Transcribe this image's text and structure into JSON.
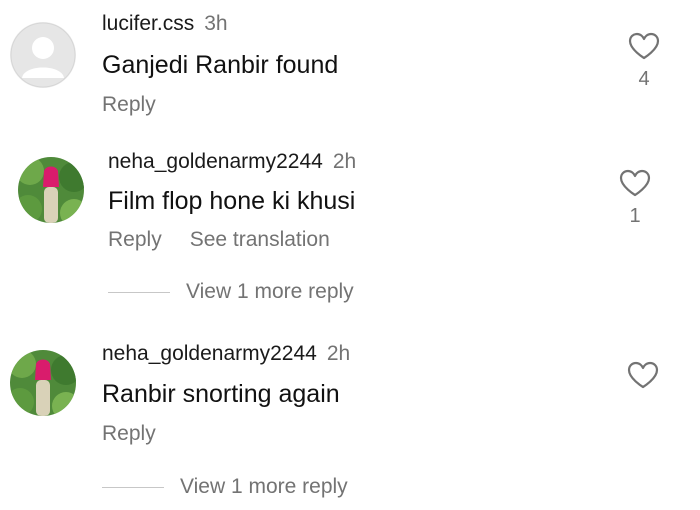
{
  "comments": [
    {
      "username": "lucifer.css",
      "time": "3h",
      "text": "Ganjedi Ranbir found",
      "reply_label": "Reply",
      "likes": "4",
      "avatar": "default-avatar"
    },
    {
      "username": "neha_goldenarmy2244",
      "time": "2h",
      "text": "Film flop hone ki khusi",
      "reply_label": "Reply",
      "translate_label": "See translation",
      "likes": "1",
      "more_replies": "View 1 more reply",
      "avatar": "photo-avatar"
    },
    {
      "username": "neha_goldenarmy2244",
      "time": "2h",
      "text": "Ranbir snorting again",
      "reply_label": "Reply",
      "more_replies": "View 1 more reply",
      "avatar": "photo-avatar"
    }
  ],
  "colors": {
    "text": "#111111",
    "secondary": "#737373",
    "divider": "#c7c7c7",
    "default_avatar_bg": "#dbdbdb"
  }
}
